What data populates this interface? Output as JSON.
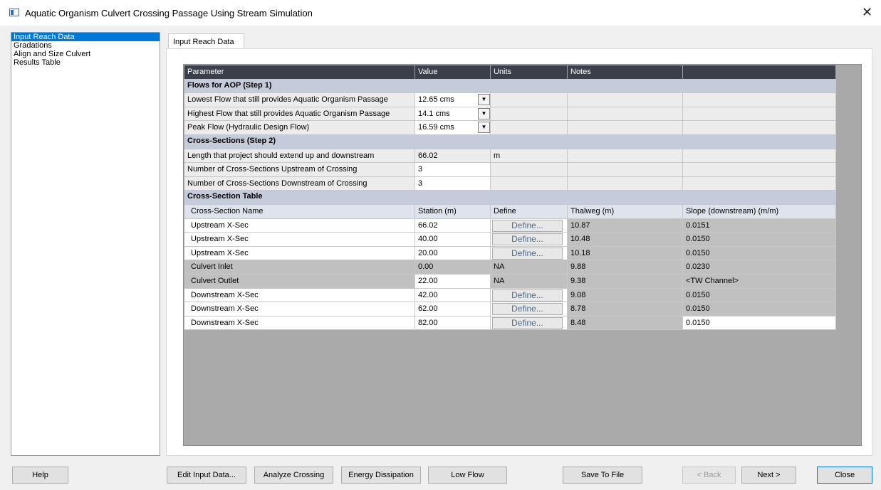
{
  "window": {
    "title": "Aquatic Organism Culvert Crossing Passage Using Stream Simulation",
    "close_glyph": "✕"
  },
  "nav": {
    "items": [
      "Input Reach Data",
      "Gradations",
      "Align and Size Culvert",
      "Results Table"
    ]
  },
  "tab": {
    "label": "Input Reach Data"
  },
  "grid": {
    "headers": [
      "Parameter",
      "Value",
      "Units",
      "Notes",
      ""
    ],
    "sections": {
      "flows": "Flows for AOP (Step 1)",
      "cross": "Cross-Sections (Step 2)",
      "table": "Cross-Section Table"
    },
    "flows": [
      {
        "param": "Lowest Flow that still provides Aquatic Organism Passage",
        "value": "12.65 cms"
      },
      {
        "param": "Highest Flow that still provides Aquatic Organism Passage",
        "value": "14.1 cms"
      },
      {
        "param": "Peak Flow (Hydraulic Design Flow)",
        "value": "16.59 cms"
      }
    ],
    "cross": [
      {
        "param": "Length that project should extend up and downstream",
        "value": "66.02",
        "units": "m"
      },
      {
        "param": "Number of Cross-Sections Upstream of Crossing",
        "value": "3",
        "units": ""
      },
      {
        "param": "Number of Cross-Sections Downstream of Crossing",
        "value": "3",
        "units": ""
      }
    ],
    "xs_headers": [
      "Cross-Section Name",
      "Station (m)",
      "Define",
      "Thalweg (m)",
      "Slope (downstream) (m/m)"
    ],
    "xs_rows": [
      {
        "name": "Upstream X-Sec",
        "station": "66.02",
        "define": "Define...",
        "thalweg": "10.87",
        "slope": "0.0151"
      },
      {
        "name": "Upstream X-Sec",
        "station": "40.00",
        "define": "Define...",
        "thalweg": "10.48",
        "slope": "0.0150"
      },
      {
        "name": "Upstream X-Sec",
        "station": "20.00",
        "define": "Define...",
        "thalweg": "10.18",
        "slope": "0.0150"
      },
      {
        "name": "Culvert Inlet",
        "station": "0.00",
        "define": "NA",
        "thalweg": "9.88",
        "slope": "0.0230"
      },
      {
        "name": "Culvert Outlet",
        "station": "22.00",
        "define": "NA",
        "thalweg": "9.38",
        "slope": "<TW Channel>"
      },
      {
        "name": "Downstream X-Sec",
        "station": "42.00",
        "define": "Define...",
        "thalweg": "9.08",
        "slope": "0.0150"
      },
      {
        "name": "Downstream X-Sec",
        "station": "62.00",
        "define": "Define...",
        "thalweg": "8.78",
        "slope": "0.0150"
      },
      {
        "name": "Downstream X-Sec",
        "station": "82.00",
        "define": "Define...",
        "thalweg": "8.48",
        "slope": "0.0150"
      }
    ]
  },
  "buttons": {
    "help": "Help",
    "edit": "Edit Input Data...",
    "analyze": "Analyze Crossing",
    "energy": "Energy Dissipation",
    "lowflow": "Low Flow",
    "save": "Save To File",
    "back": "<  Back",
    "next": "Next  >",
    "close": "Close"
  }
}
